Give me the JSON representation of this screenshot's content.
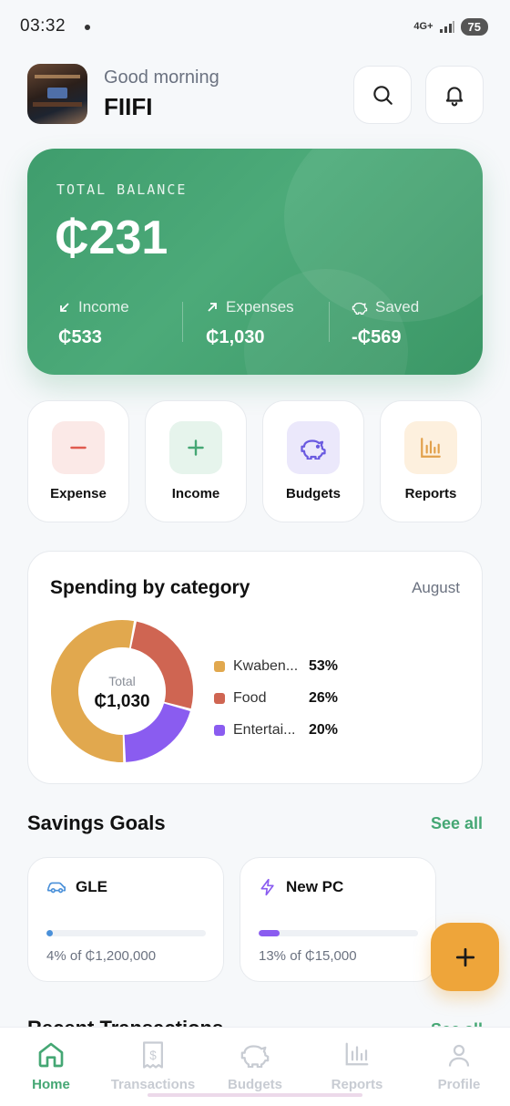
{
  "status_bar": {
    "time": "03:32",
    "network": "4G+",
    "battery": "75"
  },
  "header": {
    "greeting": "Good morning",
    "name": "FIIFI"
  },
  "balance": {
    "label": "TOTAL BALANCE",
    "amount": "₵231",
    "income_label": "Income",
    "income_value": "₵533",
    "expenses_label": "Expenses",
    "expenses_value": "₵1,030",
    "saved_label": "Saved",
    "saved_value": "-₵569"
  },
  "actions": [
    {
      "label": "Expense",
      "icon": "minus-icon",
      "color": "#e05a4f",
      "bg": "#fbe9e7"
    },
    {
      "label": "Income",
      "icon": "plus-icon",
      "color": "#45a774",
      "bg": "#e6f4ec"
    },
    {
      "label": "Budgets",
      "icon": "piggy-bank-icon",
      "color": "#6a5ae0",
      "bg": "#ebe8fb"
    },
    {
      "label": "Reports",
      "icon": "bar-chart-icon",
      "color": "#e2a04a",
      "bg": "#fdf0de"
    }
  ],
  "spending": {
    "title": "Spending by category",
    "month": "August",
    "total_label": "Total",
    "total_value": "₵1,030",
    "categories": [
      {
        "name": "Kwaben...",
        "pct_label": "53%",
        "pct": 53,
        "color": "#e1a84e"
      },
      {
        "name": "Food",
        "pct_label": "26%",
        "pct": 26,
        "color": "#cf6552"
      },
      {
        "name": "Entertai...",
        "pct_label": "20%",
        "pct": 20,
        "color": "#8a5cf0"
      }
    ]
  },
  "savings": {
    "title": "Savings Goals",
    "see_all": "See all",
    "goals": [
      {
        "name": "GLE",
        "icon": "car-icon",
        "progress": 0.04,
        "text": "4% of ₵1,200,000",
        "color": "#4a90d9"
      },
      {
        "name": "New PC",
        "icon": "lightning-icon",
        "progress": 0.13,
        "text": "13% of ₵15,000",
        "color": "#8a5cf0"
      }
    ]
  },
  "recent": {
    "title": "Recent Transactions",
    "see_all": "See all"
  },
  "tabs": [
    {
      "label": "Home",
      "icon": "home-icon",
      "active": true
    },
    {
      "label": "Transactions",
      "icon": "receipt-icon",
      "active": false
    },
    {
      "label": "Budgets",
      "icon": "piggy-bank-icon",
      "active": false
    },
    {
      "label": "Reports",
      "icon": "bar-chart-icon",
      "active": false
    },
    {
      "label": "Profile",
      "icon": "user-icon",
      "active": false
    }
  ],
  "colors": {
    "accent": "#45a774",
    "card": "#4caa79",
    "fab": "#eea53a"
  }
}
